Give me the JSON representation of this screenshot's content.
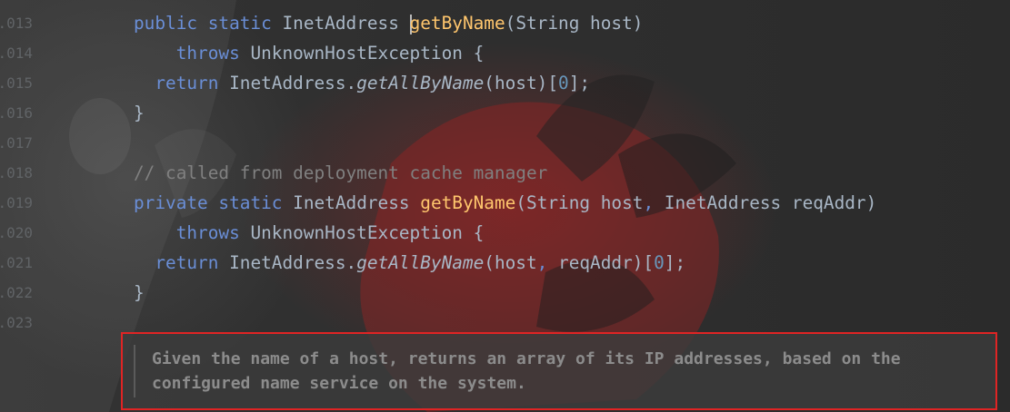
{
  "gutter": {
    "line_numbers": [
      ".013",
      ".014",
      ".015",
      ".016",
      ".017",
      ".018",
      ".019",
      ".020",
      ".021",
      ".022",
      ".023"
    ]
  },
  "code": {
    "l1": {
      "kw1": "public",
      "kw2": "static",
      "type": "InetAddress",
      "fn": "getByName",
      "rest": "(String host)"
    },
    "l2": {
      "kw": "throws",
      "rest": "UnknownHostException {"
    },
    "l3": {
      "kw": "return",
      "obj": "InetAddress.",
      "fn": "getAllByName",
      "mid": "(host)[",
      "num": "0",
      "end": "];"
    },
    "l4": {
      "text": "}"
    },
    "l6": {
      "comment": "// called from deployment cache manager"
    },
    "l7": {
      "kw1": "private",
      "kw2": "static",
      "type": "InetAddress",
      "fn": "getByName",
      "p1": "(String host",
      "comma": ",",
      "p2": " InetAddress reqAddr)"
    },
    "l8": {
      "kw": "throws",
      "rest": "UnknownHostException {"
    },
    "l9": {
      "kw": "return",
      "obj": "InetAddress.",
      "fn": "getAllByName",
      "p1": "(host",
      "comma": ",",
      "p2": " reqAddr)[",
      "num": "0",
      "end": "];"
    },
    "l10": {
      "text": "}"
    }
  },
  "doc": {
    "line1": "Given the name of a host, returns an array of its IP addresses, based on the",
    "line2": "configured name service on the system."
  },
  "colors": {
    "keyword": "#6a8ed6",
    "function": "#ffc66d",
    "number": "#6897bb",
    "comment": "#808080",
    "highlight_border": "#e02424"
  }
}
